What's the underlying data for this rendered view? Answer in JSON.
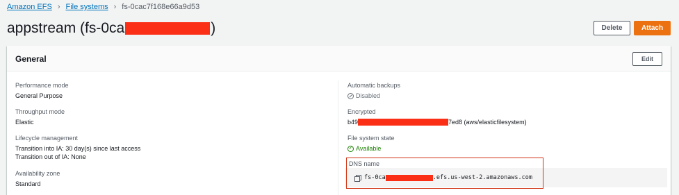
{
  "breadcrumb": {
    "items": [
      "Amazon EFS",
      "File systems"
    ],
    "current": "fs-0cac7f168e66a9d53"
  },
  "page": {
    "title_prefix": "appstream (fs-0ca",
    "title_suffix": ")"
  },
  "actions": {
    "delete_label": "Delete",
    "attach_label": "Attach"
  },
  "general": {
    "title": "General",
    "edit_label": "Edit",
    "performance_mode": {
      "label": "Performance mode",
      "value": "General Purpose"
    },
    "throughput_mode": {
      "label": "Throughput mode",
      "value": "Elastic"
    },
    "lifecycle": {
      "label": "Lifecycle management",
      "line1": "Transition into IA: 30 day(s) since last access",
      "line2": "Transition out of IA: None"
    },
    "availability_zone": {
      "label": "Availability zone",
      "value": "Standard"
    },
    "automatic_backups": {
      "label": "Automatic backups",
      "value": "Disabled"
    },
    "encrypted": {
      "label": "Encrypted",
      "prefix": "b49",
      "suffix": "7ed8 (aws/elasticfilesystem)"
    },
    "file_system_state": {
      "label": "File system state",
      "value": "Available"
    },
    "dns": {
      "label": "DNS name",
      "prefix": "fs-0ca",
      "suffix": ".efs.us-west-2.amazonaws.com"
    }
  },
  "colors": {
    "accent_link": "#0073bb",
    "primary_button": "#ec7211",
    "available": "#1d8102",
    "redaction": "#fb2e16",
    "highlight_border": "#d13212"
  }
}
